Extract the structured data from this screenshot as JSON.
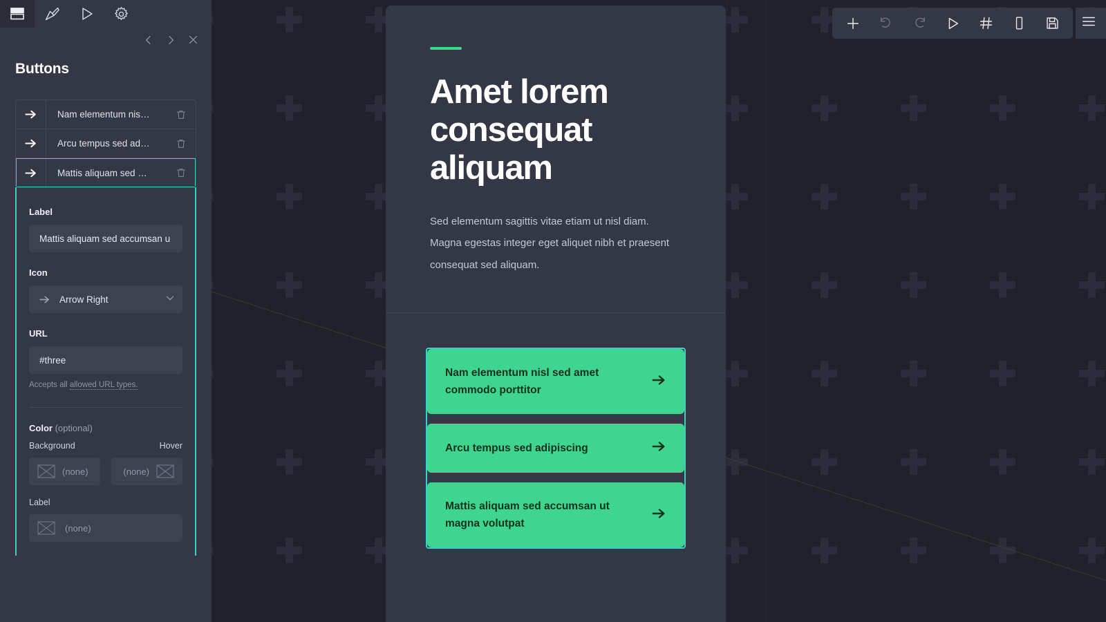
{
  "theme": {
    "accent_green": "#3ed68f",
    "accent_cyan": "#3ad1c8",
    "panel_bg": "#343845",
    "canvas_bg": "#1f212b",
    "input_bg": "#3d4251",
    "rule_green": "#3ed687"
  },
  "sidebar": {
    "tabs": [
      {
        "name": "layout-tab",
        "icon": "layout-icon",
        "active": true
      },
      {
        "name": "style-tab",
        "icon": "paintbrush-icon",
        "active": false
      },
      {
        "name": "preview-tab",
        "icon": "play-icon",
        "active": false
      },
      {
        "name": "settings-tab",
        "icon": "gear-icon",
        "active": false
      }
    ],
    "nav": {
      "prev_icon": "chevron-left-icon",
      "next_icon": "chevron-right-icon",
      "close_icon": "close-icon"
    },
    "title": "Buttons",
    "list": [
      {
        "icon": "arrow-right-icon",
        "label": "Nam elementum nis…",
        "delete_icon": "trash-icon",
        "selected": false
      },
      {
        "icon": "arrow-right-icon",
        "label": "Arcu tempus sed ad…",
        "delete_icon": "trash-icon",
        "selected": false
      },
      {
        "icon": "arrow-right-icon",
        "label": "Mattis aliquam sed …",
        "delete_icon": "trash-icon",
        "selected": true
      }
    ],
    "detail": {
      "label_field": {
        "label": "Label",
        "value": "Mattis aliquam sed accumsan u",
        "placeholder": "Label"
      },
      "icon_field": {
        "label": "Icon",
        "value": "Arrow Right",
        "icon": "arrow-right-icon",
        "chevron": "chevron-down-icon"
      },
      "url_field": {
        "label": "URL",
        "value": "#three",
        "placeholder": "URL",
        "help_prefix": "Accepts all ",
        "help_link": "allowed URL types."
      },
      "color_section": {
        "heading": "Color",
        "heading_note": "(optional)",
        "background_label": "Background",
        "hover_label": "Hover",
        "background_value": "(none)",
        "hover_value": "(none)",
        "label_label": "Label",
        "label_value": "(none)"
      }
    }
  },
  "toolbar": {
    "items": [
      {
        "name": "add-button",
        "icon": "plus-icon",
        "dim": false
      },
      {
        "name": "undo-button",
        "icon": "undo-icon",
        "dim": true
      },
      {
        "name": "redo-button",
        "icon": "redo-icon",
        "dim": true
      },
      {
        "name": "preview-button",
        "icon": "play-icon",
        "dim": false
      },
      {
        "name": "anchors-button",
        "icon": "hash-icon",
        "dim": false
      },
      {
        "name": "responsive-button",
        "icon": "mobile-icon",
        "dim": false
      },
      {
        "name": "save-button",
        "icon": "save-icon",
        "dim": false
      }
    ],
    "menu_icon": "hamburger-icon"
  },
  "preview": {
    "hero": {
      "title": "Amet lorem consequat aliquam",
      "body": "Sed elementum sagittis vitae etiam ut nisl diam. Magna egestas integer eget aliquet nibh et praesent consequat sed aliquam."
    },
    "buttons": [
      {
        "text": "Nam elementum nisl sed amet commodo porttitor",
        "icon": "arrow-right-icon"
      },
      {
        "text": "Arcu tempus sed adipiscing",
        "icon": "arrow-right-icon"
      },
      {
        "text": "Mattis aliquam sed accumsan ut magna volutpat",
        "icon": "arrow-right-icon"
      }
    ]
  }
}
